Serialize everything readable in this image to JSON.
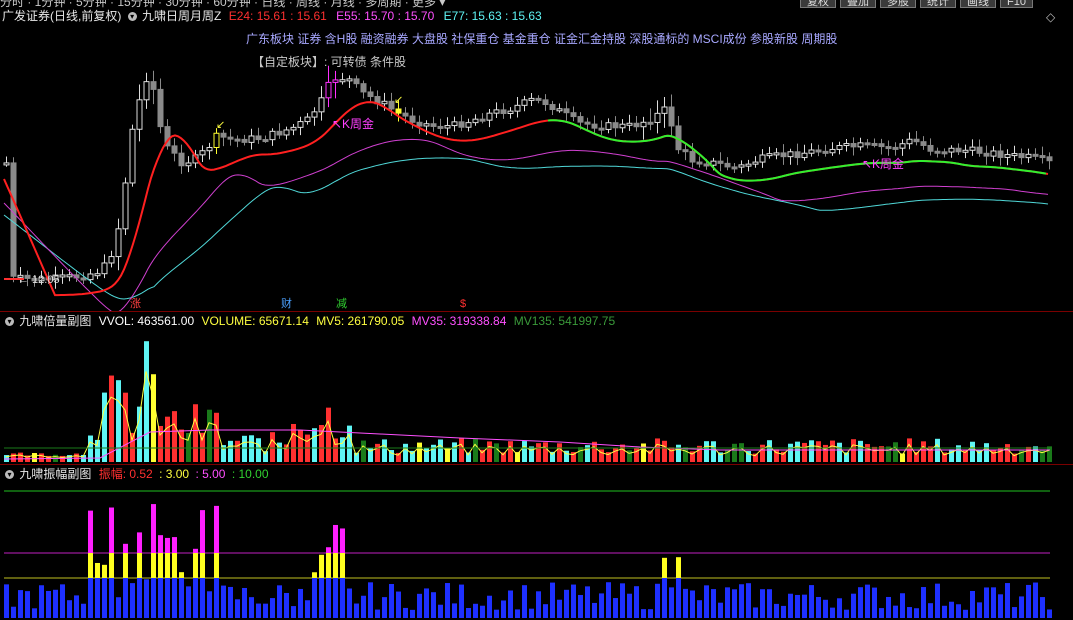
{
  "topbar": {
    "menu": "分时 · 1分钟 · 5分钟 · 15分钟 · 30分钟 · 60分钟 · 日线 · 周线 · 月线 · 多周期 · 更多 ▾",
    "buttons": [
      "复权",
      "叠加",
      "多股",
      "统计",
      "画线",
      "F10"
    ]
  },
  "main": {
    "stock": "广发证券(日线,前复权)",
    "indicator": "九啸日周月周Z",
    "ma": [
      {
        "label": "E24: 15.61",
        "value": ": 15.61",
        "color": "#ff3030"
      },
      {
        "label": "E55: 15.70",
        "value": ": 15.70",
        "color": "#ff50ff"
      },
      {
        "label": "E77: 15.63",
        "value": ": 15.63",
        "color": "#5ff5f5"
      }
    ],
    "concepts": "广东板块 证券 含H股 融资融券 大盘股 社保重仓 基金重仓 证金汇金持股 深股通标的 MSCI成份 参股新股 周期股",
    "custom": "【自定板块】: 可转债 条件股",
    "low_label": "← 12.05",
    "kzhou1": "↖K周金",
    "kzhou2": "↖K周金",
    "markers": [
      {
        "text": "涨",
        "color": "#ff4040"
      },
      {
        "text": "财",
        "color": "#4aa0ff"
      },
      {
        "text": "减",
        "color": "#30d030"
      },
      {
        "text": "$",
        "color": "#ff3030"
      }
    ]
  },
  "volume": {
    "title": "九啸倍量副图",
    "items": [
      {
        "label": "VVOL: 463561.00",
        "color": "#ffffff"
      },
      {
        "label": "VOLUME: 65671.14",
        "color": "#ffff40"
      },
      {
        "label": "MV5: 261790.05",
        "color": "#ffff40"
      },
      {
        "label": "MV35: 319338.84",
        "color": "#ff50ff"
      },
      {
        "label": "MV135: 541997.75",
        "color": "#3a9a3a"
      }
    ]
  },
  "amplitude": {
    "title": "九啸振幅副图",
    "items": [
      {
        "label": "振幅: 0.52",
        "color": "#ff3030"
      },
      {
        "label": ": 3.00",
        "color": "#ffff40"
      },
      {
        "label": ": 5.00",
        "color": "#ff50ff"
      },
      {
        "label": ": 10.00",
        "color": "#30d030"
      }
    ]
  },
  "colors": {
    "up": "#ff3030",
    "down": "#5ff5f5",
    "neutral": "#9a9a9a",
    "e24": "#ff2020",
    "e55": "#d040d0",
    "e77": "#50d8d8",
    "green_seg": "#30f030",
    "amp_blue": "#1e30ff",
    "amp_yellow": "#ffff20",
    "amp_magenta": "#ff20ff"
  }
}
